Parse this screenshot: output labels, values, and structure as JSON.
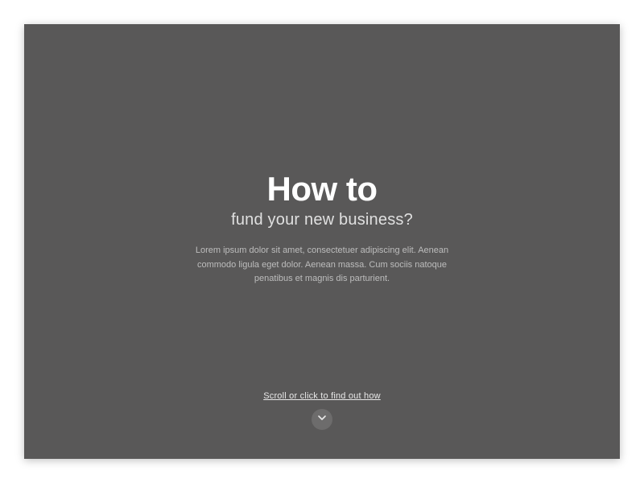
{
  "hero": {
    "title": "How to",
    "subtitle": "fund your new business?",
    "body": "Lorem ipsum dolor sit amet, consectetuer adipiscing elit. Aenean commodo ligula eget dolor. Aenean massa. Cum sociis natoque penatibus et magnis dis parturient."
  },
  "cta": {
    "link_text": "Scroll or click to find out how"
  },
  "colors": {
    "background": "#595858",
    "title": "#ffffff",
    "subtitle": "#e0e0e0",
    "body": "#bdbdbd",
    "icon_bg": "#6d6c6c"
  }
}
